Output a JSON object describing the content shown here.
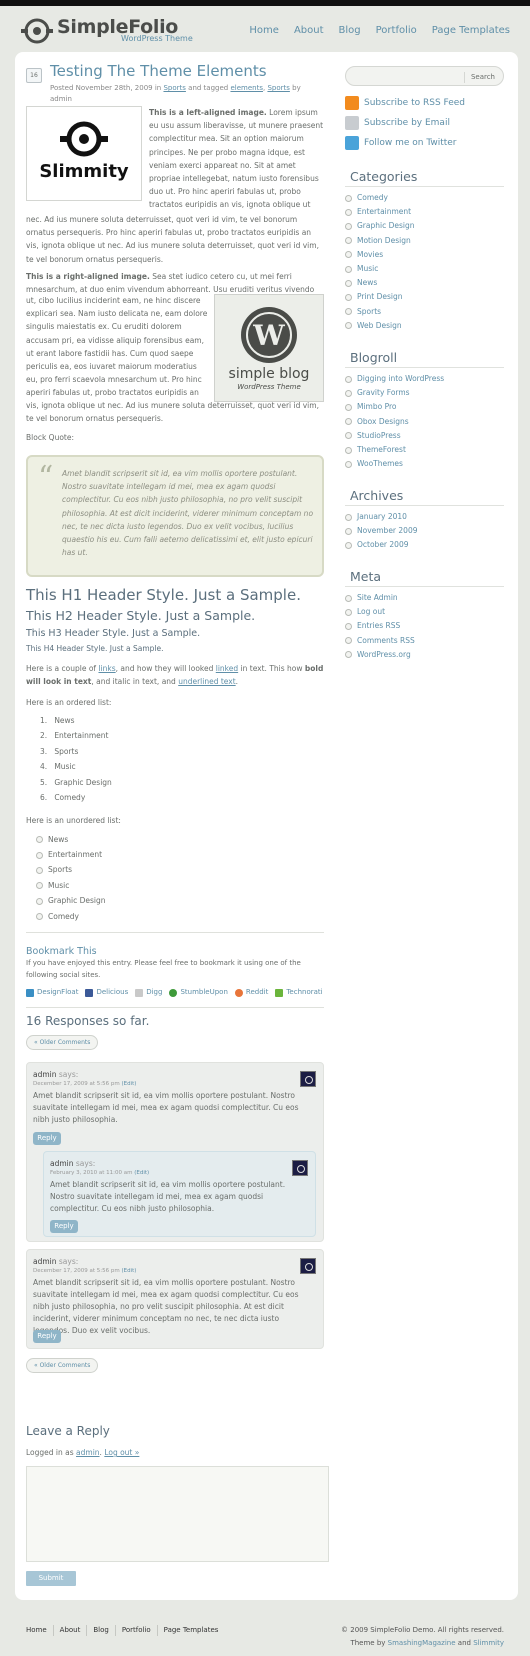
{
  "site": {
    "title": "SimpleFolio",
    "tagline": "WordPress Theme"
  },
  "nav": [
    "Home",
    "About",
    "Blog",
    "Portfolio",
    "Page Templates"
  ],
  "post": {
    "date_badge": "16",
    "title": "Testing The Theme Elements",
    "meta_posted": "Posted November 28th, 2009 in",
    "meta_category": "Sports",
    "meta_tagged": "and tagged",
    "meta_tag1": "elements",
    "meta_tag2": "Sports",
    "meta_author": "by admin",
    "left_image_text": "Slimmity",
    "left_lead": "This is a left-aligned image.",
    "left_text": "Lorem ipsum eu usu assum liberavisse, ut munere praesent complectitur mea. Sit an option maiorum principes. Ne per probo magna idque, est veniam exerci appareat no. Sit at amet propriae intellegebat, natum iusto forensibus duo ut. Pro hinc aperiri fabulas ut, probo tractatos euripidis an vis, ignota oblique ut",
    "left_text_cont": "nec. Ad ius munere soluta deterruisset, quot veri id vim, te vel bonorum ornatus persequeris. Pro hinc aperiri fabulas ut, probo tractatos euripidis an vis, ignota oblique ut nec. Ad ius munere soluta deterruisset, quot veri id vim, te vel bonorum ornatus persequeris.",
    "right_lead": "This is a right-aligned image.",
    "right_text_top": "Sea stet iudico cetero cu, ut mei ferri mnesarchum, at duo enim vivendum abhorreant. Usu eruditi veritus vivendo",
    "right_text": "ut, cibo lucilius inciderint eam, ne hinc discere explicari sea. Nam iusto delicata ne, eam dolore singulis maiestatis ex. Cu eruditi dolorem accusam pri, ea vidisse aliquip forensibus eam, ut erant labore fastidii has. Cum quod saepe periculis ea, eos iuvaret maiorum moderatius eu, pro ferri scaevola mnesarchum ut. Pro hinc aperiri fabulas ut, probo tractatos euripidis an",
    "right_text_cont": "vis, ignota oblique ut nec. Ad ius munere soluta deterruisset, quot veri id vim, te vel bonorum ornatus persequeris.",
    "right_image_title": "simple blog",
    "right_image_sub": "WordPress Theme",
    "blockquote_label": "Block Quote:",
    "blockquote": "Amet blandit scripserit sit id, ea vim mollis oportere postulant. Nostro suavitate intellegam id mei, mea ex agam quodsi complectitur. Cu eos nibh justo philosophia, no pro velit suscipit philosophia. At est dicit inciderint, viderer minimum conceptam no nec, te nec dicta iusto legendos. Duo ex velit vocibus, lucilius quaestio his eu. Cum falli aeterno delicatissimi et, elit justo epicuri has ut.",
    "h1": "This H1 Header Style. Just a Sample.",
    "h2": "This H2 Header Style. Just a Sample.",
    "h3": "This H3 Header Style. Just a Sample.",
    "h4": "This H4 Header Style. Just a Sample.",
    "links_p1": "Here is a couple of",
    "links_link1": "links",
    "links_p2": ", and how they will looked",
    "links_link2": "linked",
    "links_p3": "in text. This how",
    "links_bold": "bold will look in text",
    "links_p4": ", and italic in text, and",
    "links_link3": "underlined text",
    "links_p5": ".",
    "ol_label": "Here is an ordered list:",
    "ol": [
      "News",
      "Entertainment",
      "Sports",
      "Music",
      "Graphic Design",
      "Comedy"
    ],
    "ul_label": "Here is an unordered list:",
    "ul": [
      "News",
      "Entertainment",
      "Sports",
      "Music",
      "Graphic Design",
      "Comedy"
    ]
  },
  "bookmark": {
    "title": "Bookmark This",
    "text": "If you have enjoyed this entry. Please feel free to bookmark it using one of the following social sites.",
    "links": [
      {
        "label": "DesignFloat",
        "color": "#3a8fc4"
      },
      {
        "label": "Delicious",
        "color": "#3b5998"
      },
      {
        "label": "Digg",
        "color": "#c9c9c9"
      },
      {
        "label": "StumbleUpon",
        "color": "#3e9a3a"
      },
      {
        "label": "Reddit",
        "color": "#e8753a"
      },
      {
        "label": "Technorati",
        "color": "#6bb53b"
      }
    ]
  },
  "comments": {
    "count_title": "16 Responses so far.",
    "older_label": "« Older Comments",
    "reply_label": "Reply",
    "says": "says:",
    "items": [
      {
        "author": "admin",
        "date": "December 17, 2009 at 5:56 pm",
        "edit": "(Edit)",
        "text": "Amet blandit scripserit sit id, ea vim mollis oportere postulant. Nostro suavitate intellegam id mei, mea ex agam quodsi complectitur. Cu eos nibh justo philosophia."
      },
      {
        "author": "admin",
        "date": "February 3, 2010 at 11:00 am",
        "edit": "(Edit)",
        "text": "Amet blandit scripserit sit id, ea vim mollis oportere postulant. Nostro suavitate intellegam id mei, mea ex agam quodsi complectitur. Cu eos nibh justo philosophia."
      },
      {
        "author": "admin",
        "date": "December 17, 2009 at 5:56 pm",
        "edit": "(Edit)",
        "text": "Amet blandit scripserit sit id, ea vim mollis oportere postulant. Nostro suavitate intellegam id mei, mea ex agam quodsi complectitur. Cu eos nibh justo philosophia, no pro velit suscipit philosophia. At est dicit inciderint, viderer minimum conceptam no nec, te nec dicta iusto legendos. Duo ex velit vocibus."
      }
    ]
  },
  "reply_form": {
    "title": "Leave a Reply",
    "logged_in": "Logged in as",
    "user": "admin",
    "logout": "Log out »",
    "submit": "Submit"
  },
  "sidebar": {
    "search_button": "Search",
    "subscribe": [
      {
        "label": "Subscribe to RSS Feed",
        "icon": "rss-icon",
        "color": "#f28b1e"
      },
      {
        "label": "Subscribe by Email",
        "icon": "email-icon",
        "color": "#c8ccd0"
      },
      {
        "label": "Follow me on Twitter",
        "icon": "twitter-icon",
        "color": "#4aa3d9"
      }
    ],
    "categories_title": "Categories",
    "categories": [
      "Comedy",
      "Entertainment",
      "Graphic Design",
      "Motion Design",
      "Movies",
      "Music",
      "News",
      "Print Design",
      "Sports",
      "Web Design"
    ],
    "blogroll_title": "Blogroll",
    "blogroll": [
      "Digging into WordPress",
      "Gravity Forms",
      "Mimbo Pro",
      "Obox Designs",
      "StudioPress",
      "ThemeForest",
      "WooThemes"
    ],
    "archives_title": "Archives",
    "archives": [
      "January 2010",
      "November 2009",
      "October 2009"
    ],
    "meta_title": "Meta",
    "meta": [
      "Site Admin",
      "Log out",
      "Entries RSS",
      "Comments RSS",
      "WordPress.org"
    ]
  },
  "footer": {
    "links": [
      "Home",
      "About",
      "Blog",
      "Portfolio",
      "Page Templates"
    ],
    "copyright": "© 2009 SimpleFolio Demo. All rights reserved.",
    "theme_by": "Theme by",
    "credit1": "SmashingMagazine",
    "and": "and",
    "credit2": "Slimmity"
  },
  "colors": {
    "accent": "#5f8fa8",
    "background": "#e7e9e4",
    "heading": "#5b6f7d"
  }
}
